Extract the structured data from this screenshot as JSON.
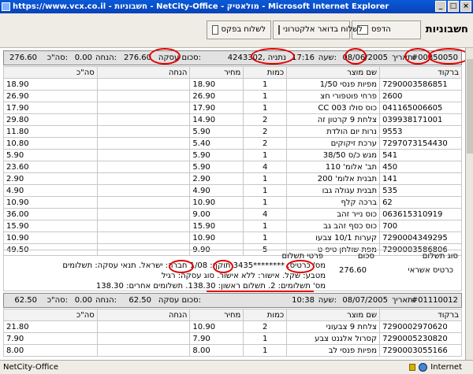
{
  "window": {
    "title": "https://www.vcx.co.il - חשבוניות - NetCity-Office - מולאטיק - Microsoft Internet Explorer"
  },
  "toolbar": {
    "page_title": "חשבוניות",
    "print_label": "הדפס",
    "email_label": "לשלוח בדואר אלקטרוני",
    "fax_label": "לשלוח בפקס"
  },
  "invoice1": {
    "id": "#00850050",
    "date_label": "תאריך:",
    "date": "08/06/2005",
    "time_label": "שעה:",
    "time": "17:16",
    "customer": "4243302, נתניה",
    "total_label": "סכום עסקה:",
    "total": "276.60",
    "discount_label": "הנחה:",
    "discount": "0.00",
    "grand_label": "סה\"כ:",
    "grand": "276.60",
    "columns": [
      "ברקוד",
      "שם מוצר",
      "כמות",
      "מחיר",
      "הנחה",
      "סה\"כ"
    ],
    "rows": [
      [
        "7290003586851",
        "מפיות פנסי 1/50",
        "1",
        "18.90",
        "",
        "18.90"
      ],
      [
        "2600",
        "פרחי פוטפורי חצ",
        "1",
        "26.90",
        "",
        "26.90"
      ],
      [
        "041165006605",
        "כוס סולו 003 CC",
        "1",
        "17.90",
        "",
        "17.90"
      ],
      [
        "039938171001",
        "צלחת 9 קרטון זה",
        "2",
        "14.90",
        "",
        "29.80"
      ],
      [
        "9553",
        "נרות יום הולדת",
        "2",
        "5.90",
        "",
        "11.80"
      ],
      [
        "7297073154430",
        "ערכת זיקוקים",
        "2",
        "5.40",
        "",
        "10.80"
      ],
      [
        "541",
        "מגש כ/ס 38/50",
        "1",
        "5.90",
        "",
        "5.90"
      ],
      [
        "450",
        "תב' אלומ' 110",
        "4",
        "5.90",
        "",
        "23.60"
      ],
      [
        "141",
        "תבנית אלומ' 200",
        "1",
        "2.90",
        "",
        "2.90"
      ],
      [
        "535",
        "תבנית עגולה גבו",
        "1",
        "4.90",
        "",
        "4.90"
      ],
      [
        "62",
        "ברכה קלף",
        "1",
        "10.90",
        "",
        "10.90"
      ],
      [
        "063615310919",
        "כוס נייר זהב",
        "4",
        "9.00",
        "",
        "36.00"
      ],
      [
        "700",
        "כוס כסף זהב גב",
        "1",
        "15.90",
        "",
        "15.90"
      ],
      [
        "7290004349295",
        "קערות 10/1 צבעו",
        "1",
        "10.90",
        "",
        "10.90"
      ],
      [
        "7290003586806",
        "מפת שולחן טיפ ט",
        "5",
        "9.90",
        "",
        "49.50"
      ]
    ],
    "payment": {
      "type_label": "סוג תשלום",
      "amount_label": "סכום",
      "details_label": "פרטי תשלום",
      "type": "כרטיס אשראי",
      "amount": "276.60",
      "line1": "מס' כרטיס: ********3435 תוקף: 1/08 חברה: ישראל. תנאי עסקה: תשלומים",
      "line2": "מטבע: שקל. אישור: ללא אישור. סוג עסקה: רגיל",
      "line3": "מס' תשלומים: 2. תשלום ראשון: 138.30. תשלומים אחרים: 138.30"
    }
  },
  "invoice2": {
    "id": "#01110012",
    "date_label": "תאריך:",
    "date": "08/07/2005",
    "time_label": "שעה:",
    "time": "10:38",
    "total_label": "סכום עסקה:",
    "total": "62.50",
    "discount_label": "הנחה:",
    "discount": "0.00",
    "grand_label": "סה\"כ:",
    "grand": "62.50",
    "columns": [
      "ברקוד",
      "שם מוצר",
      "כמות",
      "מחיר",
      "הנחה",
      "סה\"כ"
    ],
    "rows": [
      [
        "7290002970620",
        "צלחת 9 צבעוני",
        "2",
        "10.90",
        "",
        "21.80"
      ],
      [
        "7290005230820",
        "קסרול אלגנט צבע",
        "1",
        "7.90",
        "",
        "7.90"
      ],
      [
        "7290003055166",
        "מפיות פנסי לב",
        "1",
        "8.00",
        "",
        "8.00"
      ]
    ]
  },
  "statusbar": {
    "left": "NetCity-Office",
    "zone": "Internet"
  }
}
